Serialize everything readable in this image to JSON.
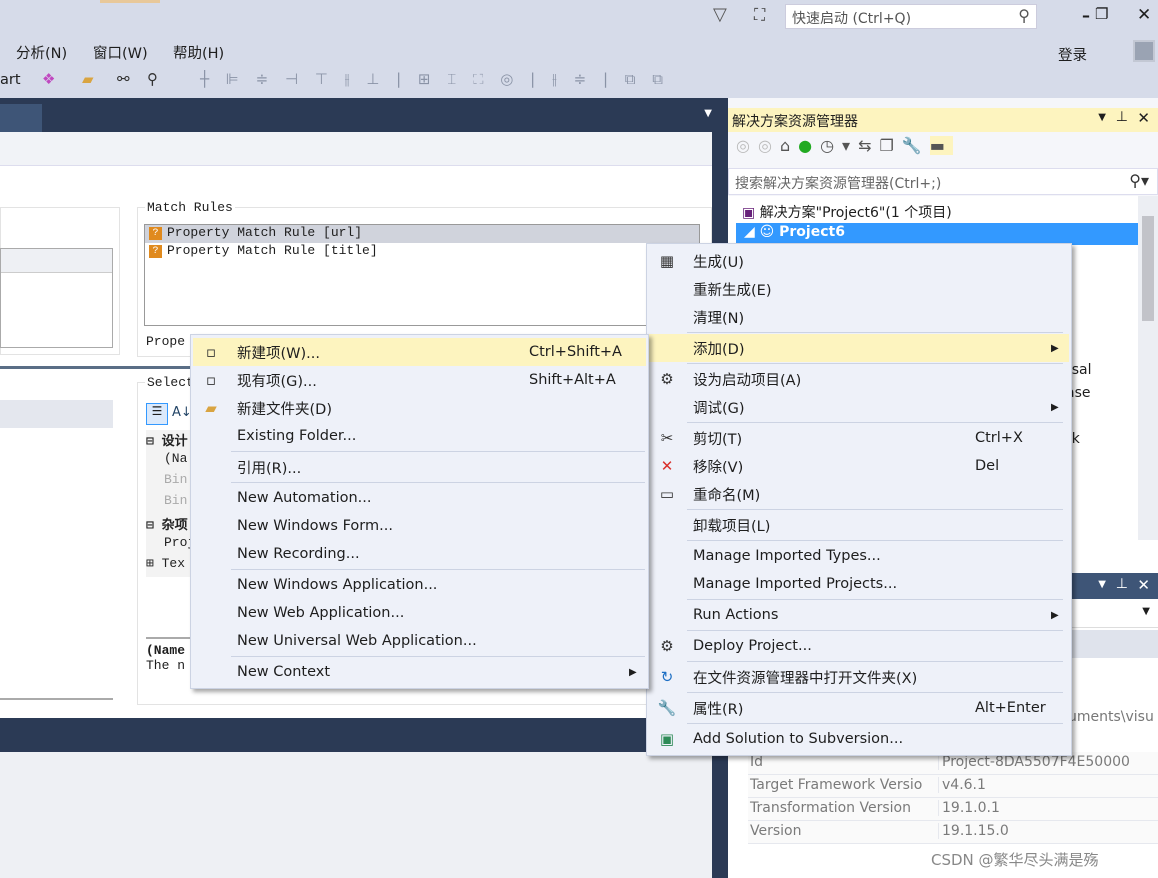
{
  "titlebar": {
    "quick_launch_placeholder": "快速启动 (Ctrl+Q)",
    "login": "登录",
    "icons": [
      "filter-icon",
      "feedback-icon",
      "search-icon",
      "minimize-icon",
      "restore-icon",
      "close-icon",
      "avatar-icon"
    ]
  },
  "menubar": {
    "items": [
      "分析(N)",
      "窗口(W)",
      "帮助(H)"
    ]
  },
  "toolbar": {
    "partial_label": "art"
  },
  "editor": {
    "match_rules_label": "Match Rules",
    "match_rules": [
      "Property Match Rule [url]",
      "Property Match Rule [title]"
    ],
    "properties_partial": "Prope",
    "selected_partial": "Select",
    "tree": [
      {
        "text": "⊟ 设计",
        "dim": false,
        "bold": true
      },
      {
        "text": "(Na",
        "dim": false
      },
      {
        "text": "Bin",
        "dim": true
      },
      {
        "text": "Bin",
        "dim": true
      },
      {
        "text": "⊟ 杂项",
        "dim": false,
        "bold": true
      },
      {
        "text": "Proj",
        "dim": false
      },
      {
        "text": "⊞ Tex",
        "dim": false
      }
    ],
    "desc_title": "(Name",
    "desc_text": "The n"
  },
  "solution_explorer": {
    "title": "解决方案资源管理器",
    "search_placeholder": "搜索解决方案资源管理器(Ctrl+;)",
    "solution_node": "解决方案\"Project6\"(1 个项目)",
    "project_node": "Project6",
    "hidden_partials": [
      "rsal",
      "ase",
      "rk"
    ]
  },
  "properties": {
    "partial_path": "uments\\visu",
    "rows": [
      {
        "name": "Id",
        "value": "Project-8DA5507F4E50000"
      },
      {
        "name": "Target Framework Versio",
        "value": "v4.6.1"
      },
      {
        "name": "Transformation Version",
        "value": "19.1.0.1"
      },
      {
        "name": "Version",
        "value": "19.1.15.0"
      }
    ]
  },
  "context_menu": {
    "items": [
      {
        "label": "生成(U)",
        "icon": "build-icon",
        "glyph": "▦"
      },
      {
        "label": "重新生成(E)"
      },
      {
        "label": "清理(N)",
        "sep_after": true
      },
      {
        "label": "添加(D)",
        "submenu": true,
        "highlighted": true,
        "sep_after": true
      },
      {
        "label": "设为启动项目(A)",
        "icon": "gear-icon",
        "glyph": "⚙"
      },
      {
        "label": "调试(G)",
        "submenu": true,
        "sep_after": true
      },
      {
        "label": "剪切(T)",
        "shortcut": "Ctrl+X",
        "icon": "scissors-icon",
        "glyph": "✂"
      },
      {
        "label": "移除(V)",
        "shortcut": "Del",
        "icon": "remove-icon",
        "glyph": "✕",
        "color": "#d9302c"
      },
      {
        "label": "重命名(M)",
        "icon": "rename-icon",
        "glyph": "▭",
        "sep_after": true
      },
      {
        "label": "卸载项目(L)",
        "sep_after": true
      },
      {
        "label": "Manage Imported Types..."
      },
      {
        "label": "Manage Imported Projects...",
        "sep_after": true
      },
      {
        "label": "Run Actions",
        "submenu": true,
        "sep_after": true
      },
      {
        "label": "Deploy Project...",
        "icon": "deploy-icon",
        "glyph": "⚙",
        "sep_after": true
      },
      {
        "label": "在文件资源管理器中打开文件夹(X)",
        "icon": "open-folder-icon",
        "glyph": "↻",
        "color": "#1e6fc4",
        "sep_after": true
      },
      {
        "label": "属性(R)",
        "shortcut": "Alt+Enter",
        "icon": "wrench-icon",
        "glyph": "🔧",
        "sep_after": true
      },
      {
        "label": "Add Solution to Subversion...",
        "icon": "subversion-icon",
        "glyph": "▣",
        "color": "#2e8b57"
      }
    ]
  },
  "add_submenu": {
    "items": [
      {
        "label": "新建项(W)...",
        "shortcut": "Ctrl+Shift+A",
        "icon": "new-item-icon",
        "glyph": "▫",
        "highlighted": true
      },
      {
        "label": "现有项(G)...",
        "shortcut": "Shift+Alt+A",
        "icon": "existing-item-icon",
        "glyph": "▫"
      },
      {
        "label": "新建文件夹(D)",
        "icon": "new-folder-icon",
        "glyph": "▰",
        "color": "#d9a441"
      },
      {
        "label": "Existing Folder...",
        "sep_after": true
      },
      {
        "label": "引用(R)...",
        "sep_after": true
      },
      {
        "label": "New Automation..."
      },
      {
        "label": "New Windows Form..."
      },
      {
        "label": "New Recording...",
        "sep_after": true
      },
      {
        "label": "New Windows Application..."
      },
      {
        "label": "New Web Application..."
      },
      {
        "label": "New Universal Web Application...",
        "sep_after": true
      },
      {
        "label": "New Context",
        "submenu": true
      }
    ]
  },
  "watermark": "CSDN @繁华尽头满是殇",
  "colors": {
    "highlight": "#fdf4bf",
    "dark_band": "#2b3a55",
    "selection": "#3399ff"
  }
}
